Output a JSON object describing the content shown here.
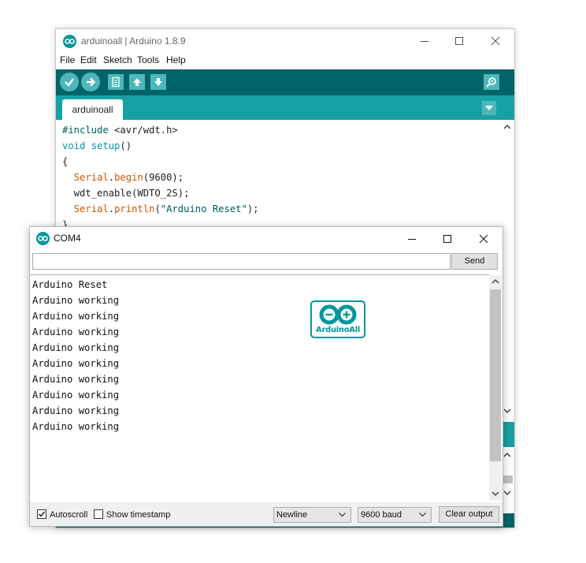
{
  "ide": {
    "title": "arduinoall | Arduino 1.8.9",
    "menu": [
      "File",
      "Edit",
      "Sketch",
      "Tools",
      "Help"
    ],
    "tab": "arduinoall",
    "code": {
      "line1": {
        "a": "#include",
        "b": " <avr/wdt.h>"
      },
      "line2": {
        "a": "void",
        "b": " ",
        "c": "setup",
        "d": "()"
      },
      "line3": "{",
      "line4": {
        "a": "  ",
        "b": "Serial",
        "c": ".",
        "d": "begin",
        "e": "(9600);"
      },
      "line5": "  wdt_enable(WDTO_2S);",
      "line6": {
        "a": "  ",
        "b": "Serial",
        "c": ".",
        "d": "println",
        "e": "(",
        "f": "\"Arduino Reset\"",
        "g": ");"
      },
      "line7": "}"
    }
  },
  "serial_monitor": {
    "title": "COM4",
    "input_value": "",
    "send_label": "Send",
    "output_lines": [
      "Arduino Reset",
      "Arduino working",
      "Arduino working",
      "Arduino working",
      "Arduino working",
      "Arduino working",
      "Arduino working",
      "Arduino working",
      "Arduino working",
      "Arduino working"
    ],
    "logo_text": "ArduinoAll",
    "autoscroll_label": "Autoscroll",
    "autoscroll_checked": true,
    "timestamp_label": "Show timestamp",
    "timestamp_checked": false,
    "line_ending": "Newline",
    "baud_rate": "9600 baud",
    "clear_label": "Clear output"
  },
  "colors": {
    "toolbar": "#006468",
    "tabbar": "#17a1a5",
    "button": "#4db7bb",
    "keyword": "#00979d",
    "serial": "#d35400"
  },
  "icons": [
    "arduino-app-icon",
    "verify-icon",
    "upload-icon",
    "new-icon",
    "open-icon",
    "save-icon",
    "serial-monitor-icon",
    "tab-menu-icon",
    "minimize-icon",
    "maximize-icon",
    "close-icon"
  ]
}
